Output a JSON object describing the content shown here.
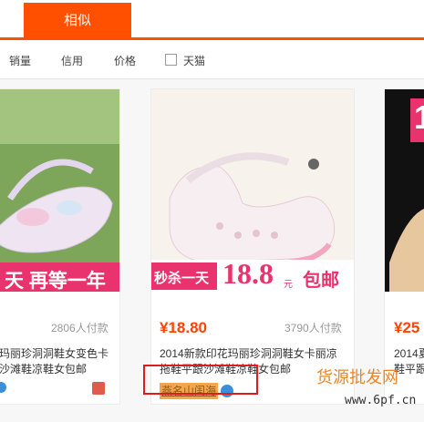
{
  "tabs": {
    "similar": "相似"
  },
  "filters": {
    "sales": "销量",
    "credit": "信用",
    "price": "价格",
    "tmall": "天猫"
  },
  "products": [
    {
      "banner": "天  再等一年",
      "sales": "2806人付款",
      "desc1": "玛丽珍洞洞鞋女变色卡",
      "desc2": "沙滩鞋凉鞋女包邮"
    },
    {
      "banner_left": "秒杀一天",
      "banner_price": "18.8",
      "banner_unit": "元",
      "banner_right": "包邮",
      "price": "¥18.80",
      "sales": "3790人付款",
      "desc1": "2014新款印花玛丽珍洞洞鞋女卡丽凉",
      "desc2": "拖鞋平跟沙滩鞋凉鞋女包邮",
      "shop": "燕名山闺海"
    },
    {
      "banner_top": "1",
      "price": "¥25",
      "desc1": "2014夏",
      "desc2": "鞋平跟"
    }
  ],
  "watermark": {
    "text": "货源批发网",
    "url": "www.6pf.cn"
  },
  "colors": {
    "accent": "#ff5000",
    "price": "#ff4400",
    "highlight": "#e01b1b"
  }
}
